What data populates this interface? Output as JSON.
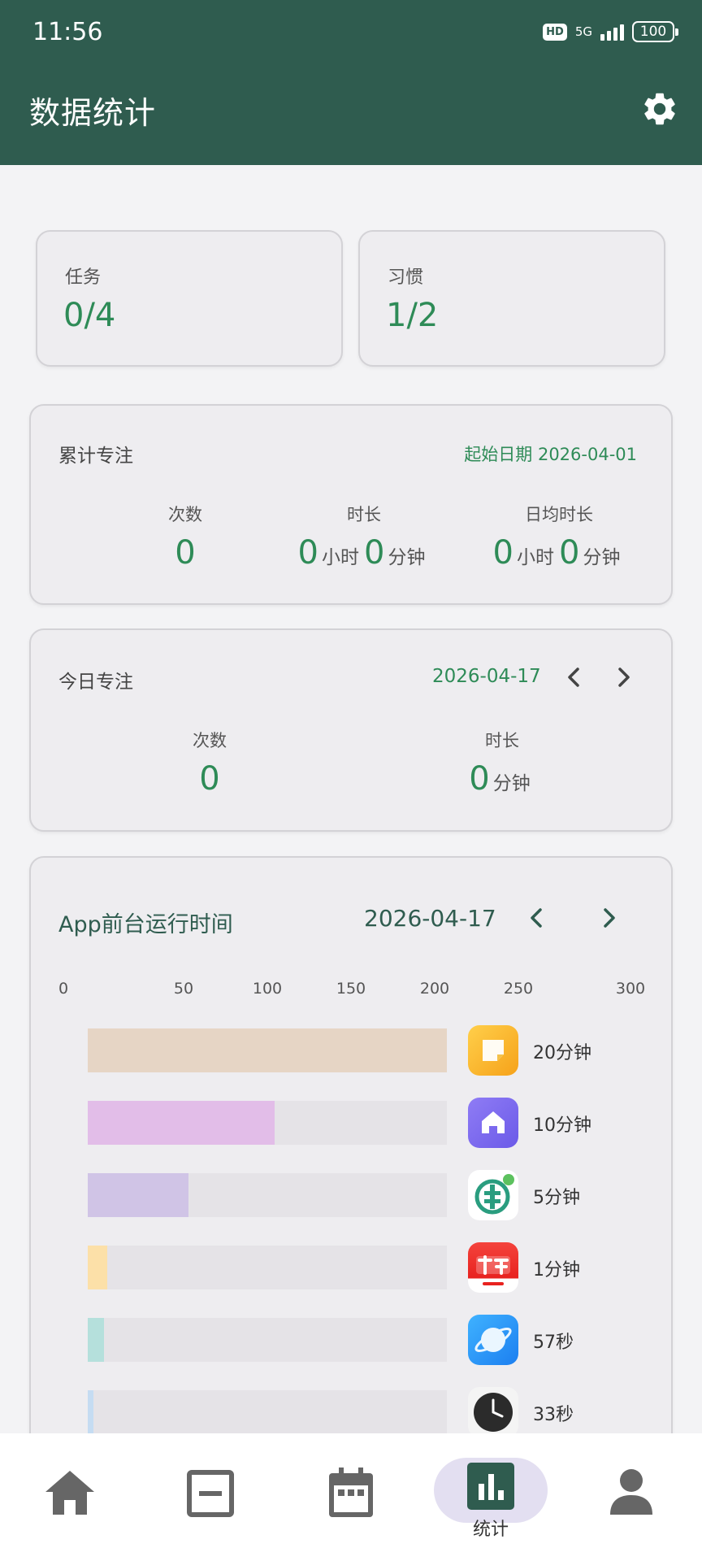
{
  "status": {
    "time": "11:56",
    "hd": "HD",
    "network": "5G",
    "battery": "100"
  },
  "header": {
    "title": "数据统计"
  },
  "summary": {
    "tasks": {
      "label": "任务",
      "value": "0/4"
    },
    "habits": {
      "label": "习惯",
      "value": "1/2"
    }
  },
  "cumulative": {
    "title": "累计专注",
    "start_date": "起始日期 2026-04-01",
    "count_label": "次数",
    "count_value": "0",
    "duration_label": "时长",
    "duration_hours": "0",
    "duration_minutes": "0",
    "avg_label": "日均时长",
    "avg_hours": "0",
    "avg_minutes": "0",
    "unit_hour": "小时",
    "unit_minute": "分钟"
  },
  "today": {
    "title": "今日专注",
    "date": "2026-04-17",
    "count_label": "次数",
    "count_value": "0",
    "duration_label": "时长",
    "duration_value": "0",
    "unit_minute": "分钟"
  },
  "app_usage": {
    "title": "App前台运行时间",
    "date": "2026-04-17",
    "ticks": [
      "0",
      "50",
      "100",
      "150",
      "200",
      "250",
      "300"
    ],
    "rows": [
      {
        "icon": "notes-app-icon",
        "color": "#e6d5c5",
        "fill": 1.0,
        "duration": "20分钟"
      },
      {
        "icon": "home-launcher-icon",
        "color": "#e2bde8",
        "fill": 0.52,
        "duration": "10分钟"
      },
      {
        "icon": "bank-app-icon",
        "color": "#d0c4e6",
        "fill": 0.28,
        "duration": "5分钟"
      },
      {
        "icon": "kandian-app-icon",
        "color": "#fce0a8",
        "fill": 0.055,
        "duration": "1分钟"
      },
      {
        "icon": "browser-planet-icon",
        "color": "#b5e0dc",
        "fill": 0.045,
        "duration": "57秒"
      },
      {
        "icon": "clock-app-icon",
        "color": "#c5dcf2",
        "fill": 0.015,
        "duration": "33秒"
      }
    ]
  },
  "nav": {
    "active_label": "统计"
  },
  "colors": {
    "header_bg": "#2f5c4f",
    "accent_green": "#2e8b57",
    "nav_pill": "#e3dff1"
  }
}
